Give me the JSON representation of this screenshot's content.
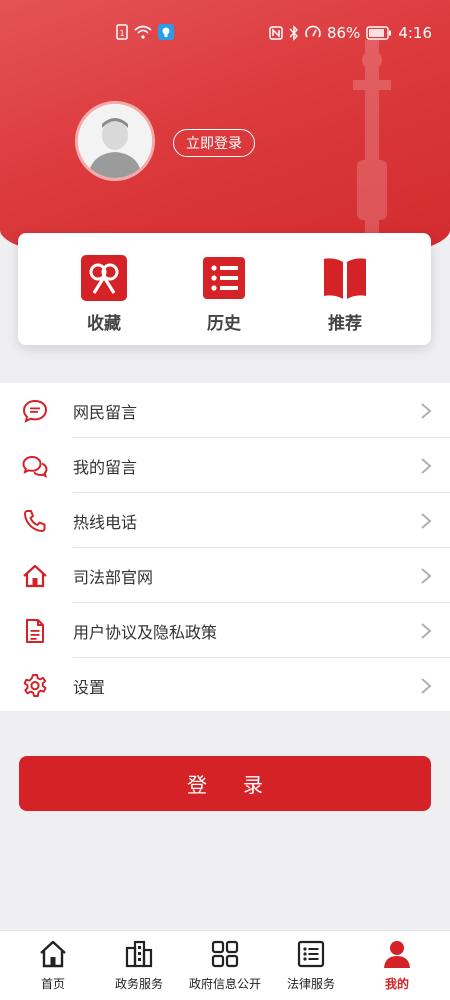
{
  "colors": {
    "accent": "#d42226",
    "header": "#dc3a3d",
    "background": "#efeff2"
  },
  "status_bar": {
    "battery": "86%",
    "time": "4:16"
  },
  "profile": {
    "login_link": "立即登录"
  },
  "quick_actions": [
    {
      "label": "收藏",
      "icon": "ribbon-icon"
    },
    {
      "label": "历史",
      "icon": "list-icon"
    },
    {
      "label": "推荐",
      "icon": "book-icon"
    }
  ],
  "menu": [
    {
      "label": "网民留言",
      "icon": "chat-bubble-icon"
    },
    {
      "label": "我的留言",
      "icon": "chat-bubbles-icon"
    },
    {
      "label": "热线电话",
      "icon": "phone-icon"
    },
    {
      "label": "司法部官网",
      "icon": "home-icon"
    },
    {
      "label": "用户协议及隐私政策",
      "icon": "document-icon"
    },
    {
      "label": "设置",
      "icon": "gear-icon"
    }
  ],
  "login_button": "登录",
  "bottom_nav": [
    {
      "label": "首页",
      "icon": "home-icon",
      "active": false
    },
    {
      "label": "政务服务",
      "icon": "building-icon",
      "active": false
    },
    {
      "label": "政府信息公开",
      "icon": "grid-icon",
      "active": false
    },
    {
      "label": "法律服务",
      "icon": "list-icon",
      "active": false
    },
    {
      "label": "我的",
      "icon": "user-icon",
      "active": true
    }
  ]
}
